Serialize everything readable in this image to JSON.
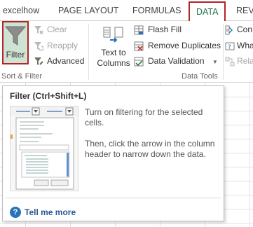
{
  "tabs": [
    {
      "label": "excelhow",
      "active": false
    },
    {
      "label": "PAGE LAYOUT",
      "active": false
    },
    {
      "label": "FORMULAS",
      "active": false
    },
    {
      "label": "DATA",
      "active": true
    },
    {
      "label": "REV",
      "active": false
    }
  ],
  "ribbon": {
    "sort_filter": {
      "filter_label": "Filter",
      "clear_label": "Clear",
      "reapply_label": "Reapply",
      "advanced_label": "Advanced",
      "group_label": "Sort & Filter"
    },
    "data_tools": {
      "text_to_columns_line1": "Text to",
      "text_to_columns_line2": "Columns",
      "flash_fill_label": "Flash Fill",
      "remove_duplicates_label": "Remove Duplicates",
      "data_validation_label": "Data Validation",
      "group_label": "Data Tools"
    },
    "cut_off": {
      "row1": "Con",
      "row2": "Wha",
      "row3": "Rela"
    }
  },
  "tooltip": {
    "title": "Filter (Ctrl+Shift+L)",
    "line1": "Turn on filtering for the selected cells.",
    "line2": "Then, click the arrow in the column header to narrow down the data.",
    "more_label": "Tell me more",
    "help_glyph": "?"
  },
  "colors": {
    "accent_green": "#217346",
    "highlight_red": "#b02525",
    "filter_bg": "#cfe3d3",
    "link_blue": "#2b5797"
  }
}
